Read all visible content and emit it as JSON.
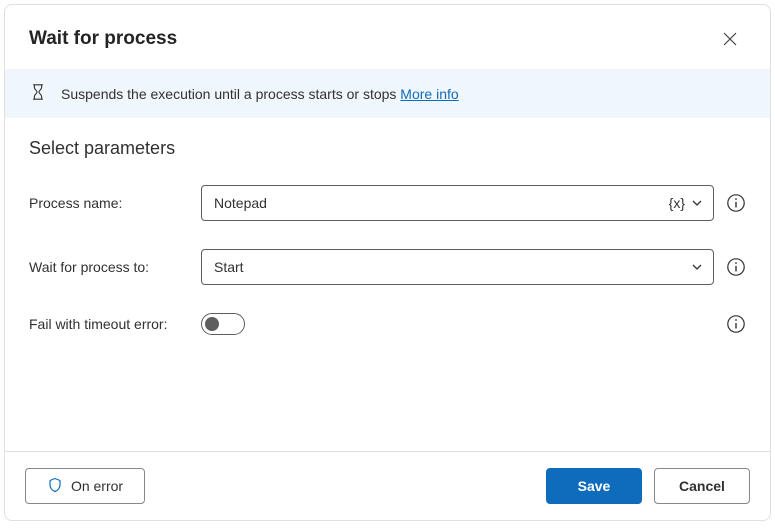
{
  "header": {
    "title": "Wait for process"
  },
  "banner": {
    "text": "Suspends the execution until a process starts or stops ",
    "link": "More info"
  },
  "section": {
    "title": "Select parameters"
  },
  "fields": {
    "process_name": {
      "label": "Process name:",
      "value": "Notepad",
      "var_icon": "{x}"
    },
    "wait_for": {
      "label": "Wait for process to:",
      "value": "Start"
    },
    "fail_timeout": {
      "label": "Fail with timeout error:"
    }
  },
  "footer": {
    "on_error": "On error",
    "save": "Save",
    "cancel": "Cancel"
  }
}
